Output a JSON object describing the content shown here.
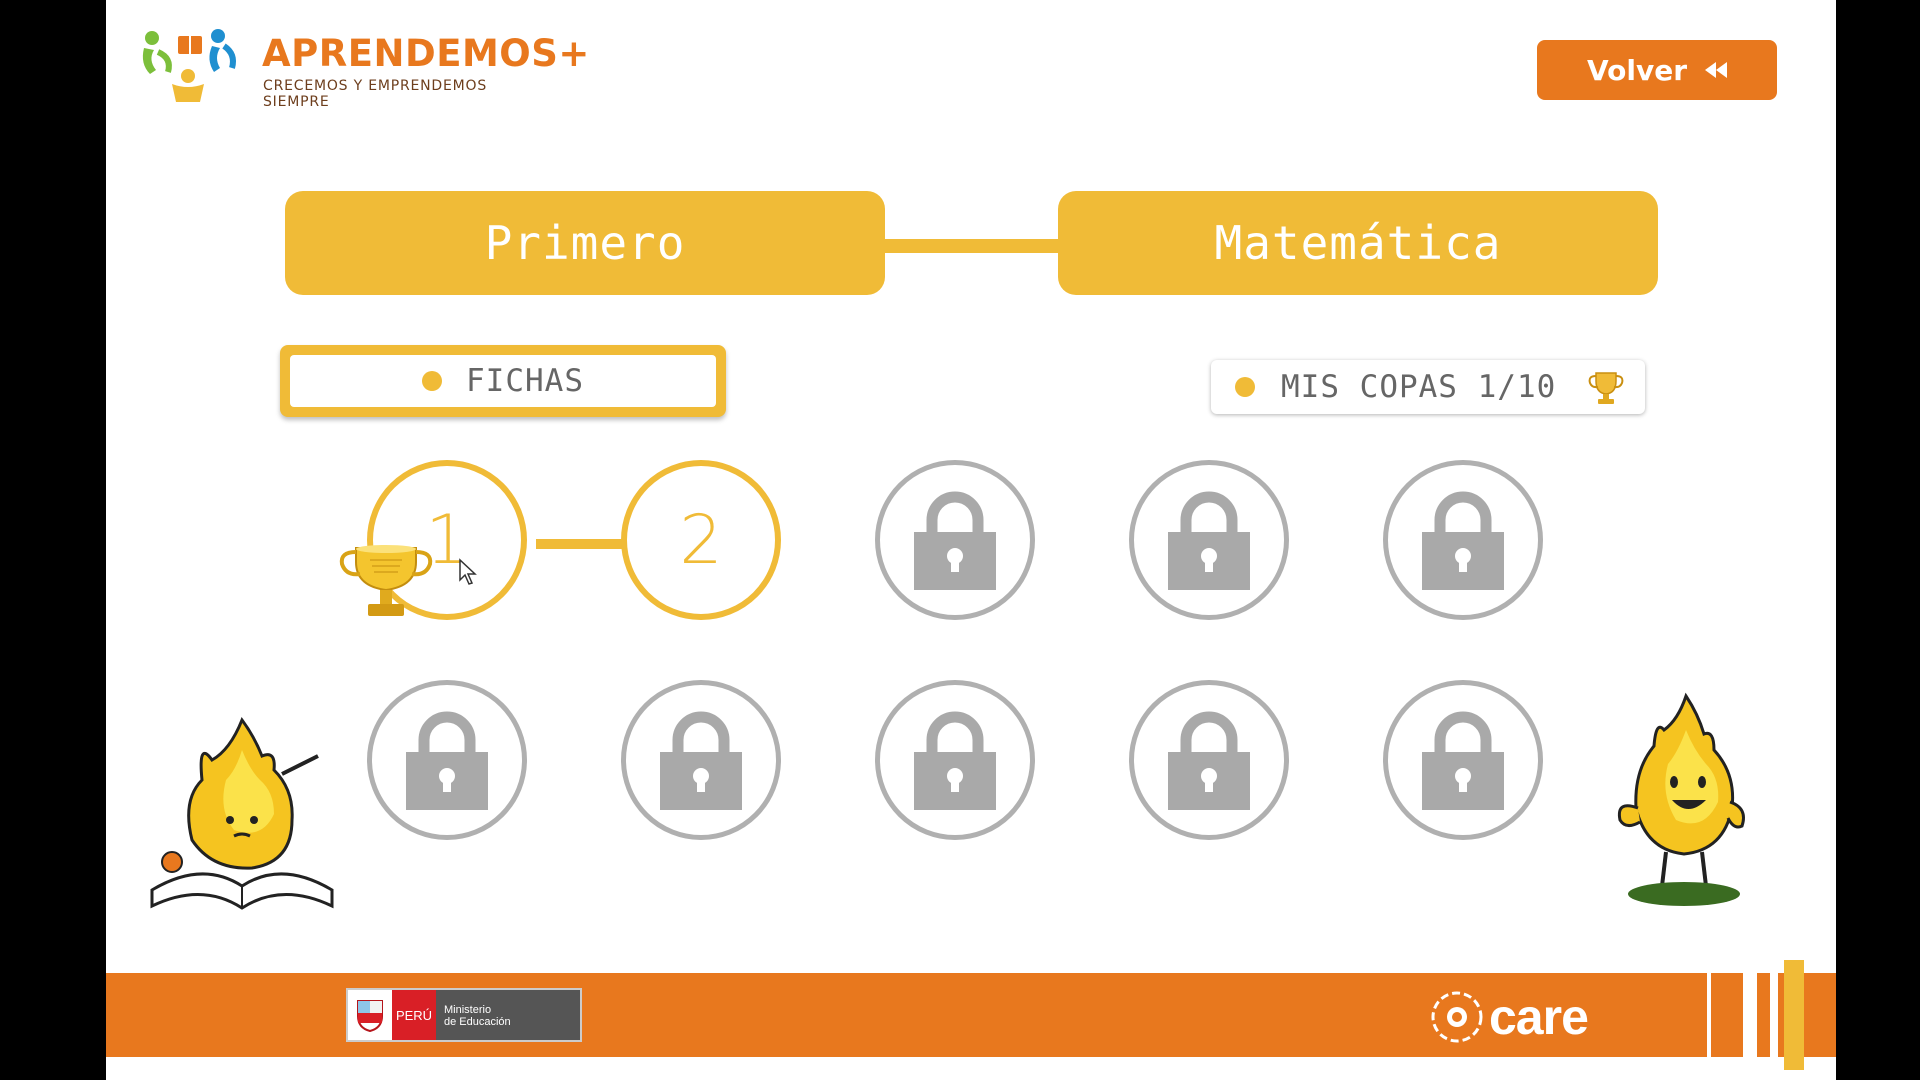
{
  "header": {
    "brand_name": "APRENDEMOS",
    "brand_plus": "+",
    "tagline": "CRECEMOS Y EMPRENDEMOS SIEMPRE",
    "back_label": "Volver"
  },
  "selection": {
    "grade": "Primero",
    "subject": "Matemática"
  },
  "tabs": {
    "fichas_label": "FICHAS",
    "copas_label": "MIS COPAS 1/10"
  },
  "lessons": [
    {
      "number": "1",
      "status": "unlocked",
      "trophy": true
    },
    {
      "number": "2",
      "status": "unlocked",
      "trophy": false
    },
    {
      "status": "locked"
    },
    {
      "status": "locked"
    },
    {
      "status": "locked"
    },
    {
      "status": "locked"
    },
    {
      "status": "locked"
    },
    {
      "status": "locked"
    },
    {
      "status": "locked"
    },
    {
      "status": "locked"
    }
  ],
  "footer": {
    "peru_label": "PERÚ",
    "ministry_line1": "Ministerio",
    "ministry_line2": "de Educación",
    "care_label": "care"
  },
  "colors": {
    "orange": "#e8781e",
    "yellow": "#f0bb37",
    "locked_gray": "#b0b0b0"
  }
}
